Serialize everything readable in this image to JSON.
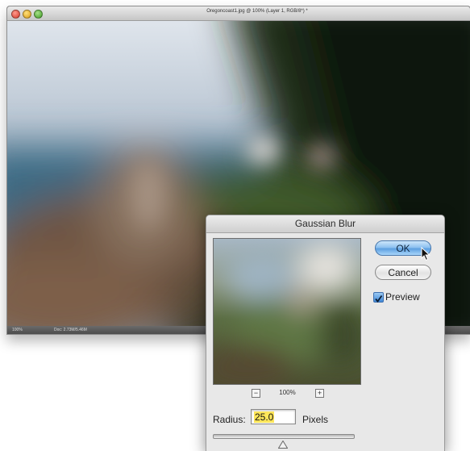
{
  "document": {
    "title": "Oregoncoast1.jpg @ 100% (Layer 1, RGB/8*) *",
    "status_zoom": "100%",
    "status_doc": "Doc: 2.73M/5.46M"
  },
  "dialog": {
    "title": "Gaussian Blur",
    "ok_label": "OK",
    "cancel_label": "Cancel",
    "preview_label": "Preview",
    "preview_checked": true,
    "zoom_out_icon": "−",
    "zoom_in_icon": "+",
    "zoom_level": "100%",
    "radius_label": "Radius:",
    "radius_value": "25.0",
    "radius_unit": "Pixels",
    "radius_slider_fraction": 0.5
  },
  "colors": {
    "ok_button": "#8ec2f0",
    "radius_highlight": "#ffe65a",
    "dialog_bg": "#e8e8e8"
  },
  "icons": [
    "close-icon",
    "minimize-icon",
    "zoom-icon",
    "zoom-out-icon",
    "zoom-in-icon",
    "checkmark-icon",
    "cursor-arrow-icon",
    "slider-thumb-icon"
  ]
}
